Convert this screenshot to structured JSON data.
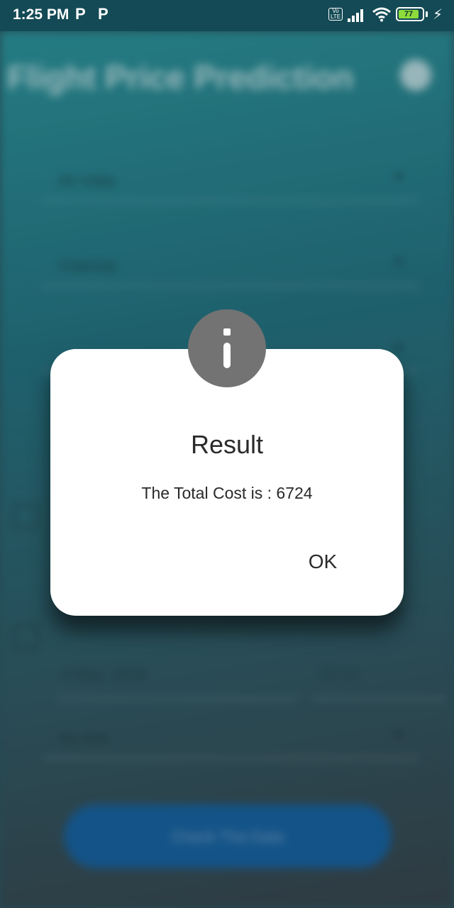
{
  "status_bar": {
    "time": "1:25 PM",
    "notif_icons": [
      "P",
      "P"
    ],
    "network_label": "Vo LTE",
    "battery_level": "77",
    "charging": true
  },
  "background_app": {
    "title": "Flight Price Prediction",
    "fields": [
      {
        "value": "Air India"
      },
      {
        "value": "Chennai"
      },
      {
        "value": ""
      },
      {
        "value": "No Info"
      }
    ],
    "date_value": "4 May, 2019",
    "time_value": "10:10",
    "submit_label": "Check The Data",
    "submit_color": "#175f9a"
  },
  "dialog": {
    "title": "Result",
    "message": "The Total Cost is : 6724",
    "ok_label": "OK",
    "icon": "info-icon",
    "icon_color": "#737373"
  }
}
